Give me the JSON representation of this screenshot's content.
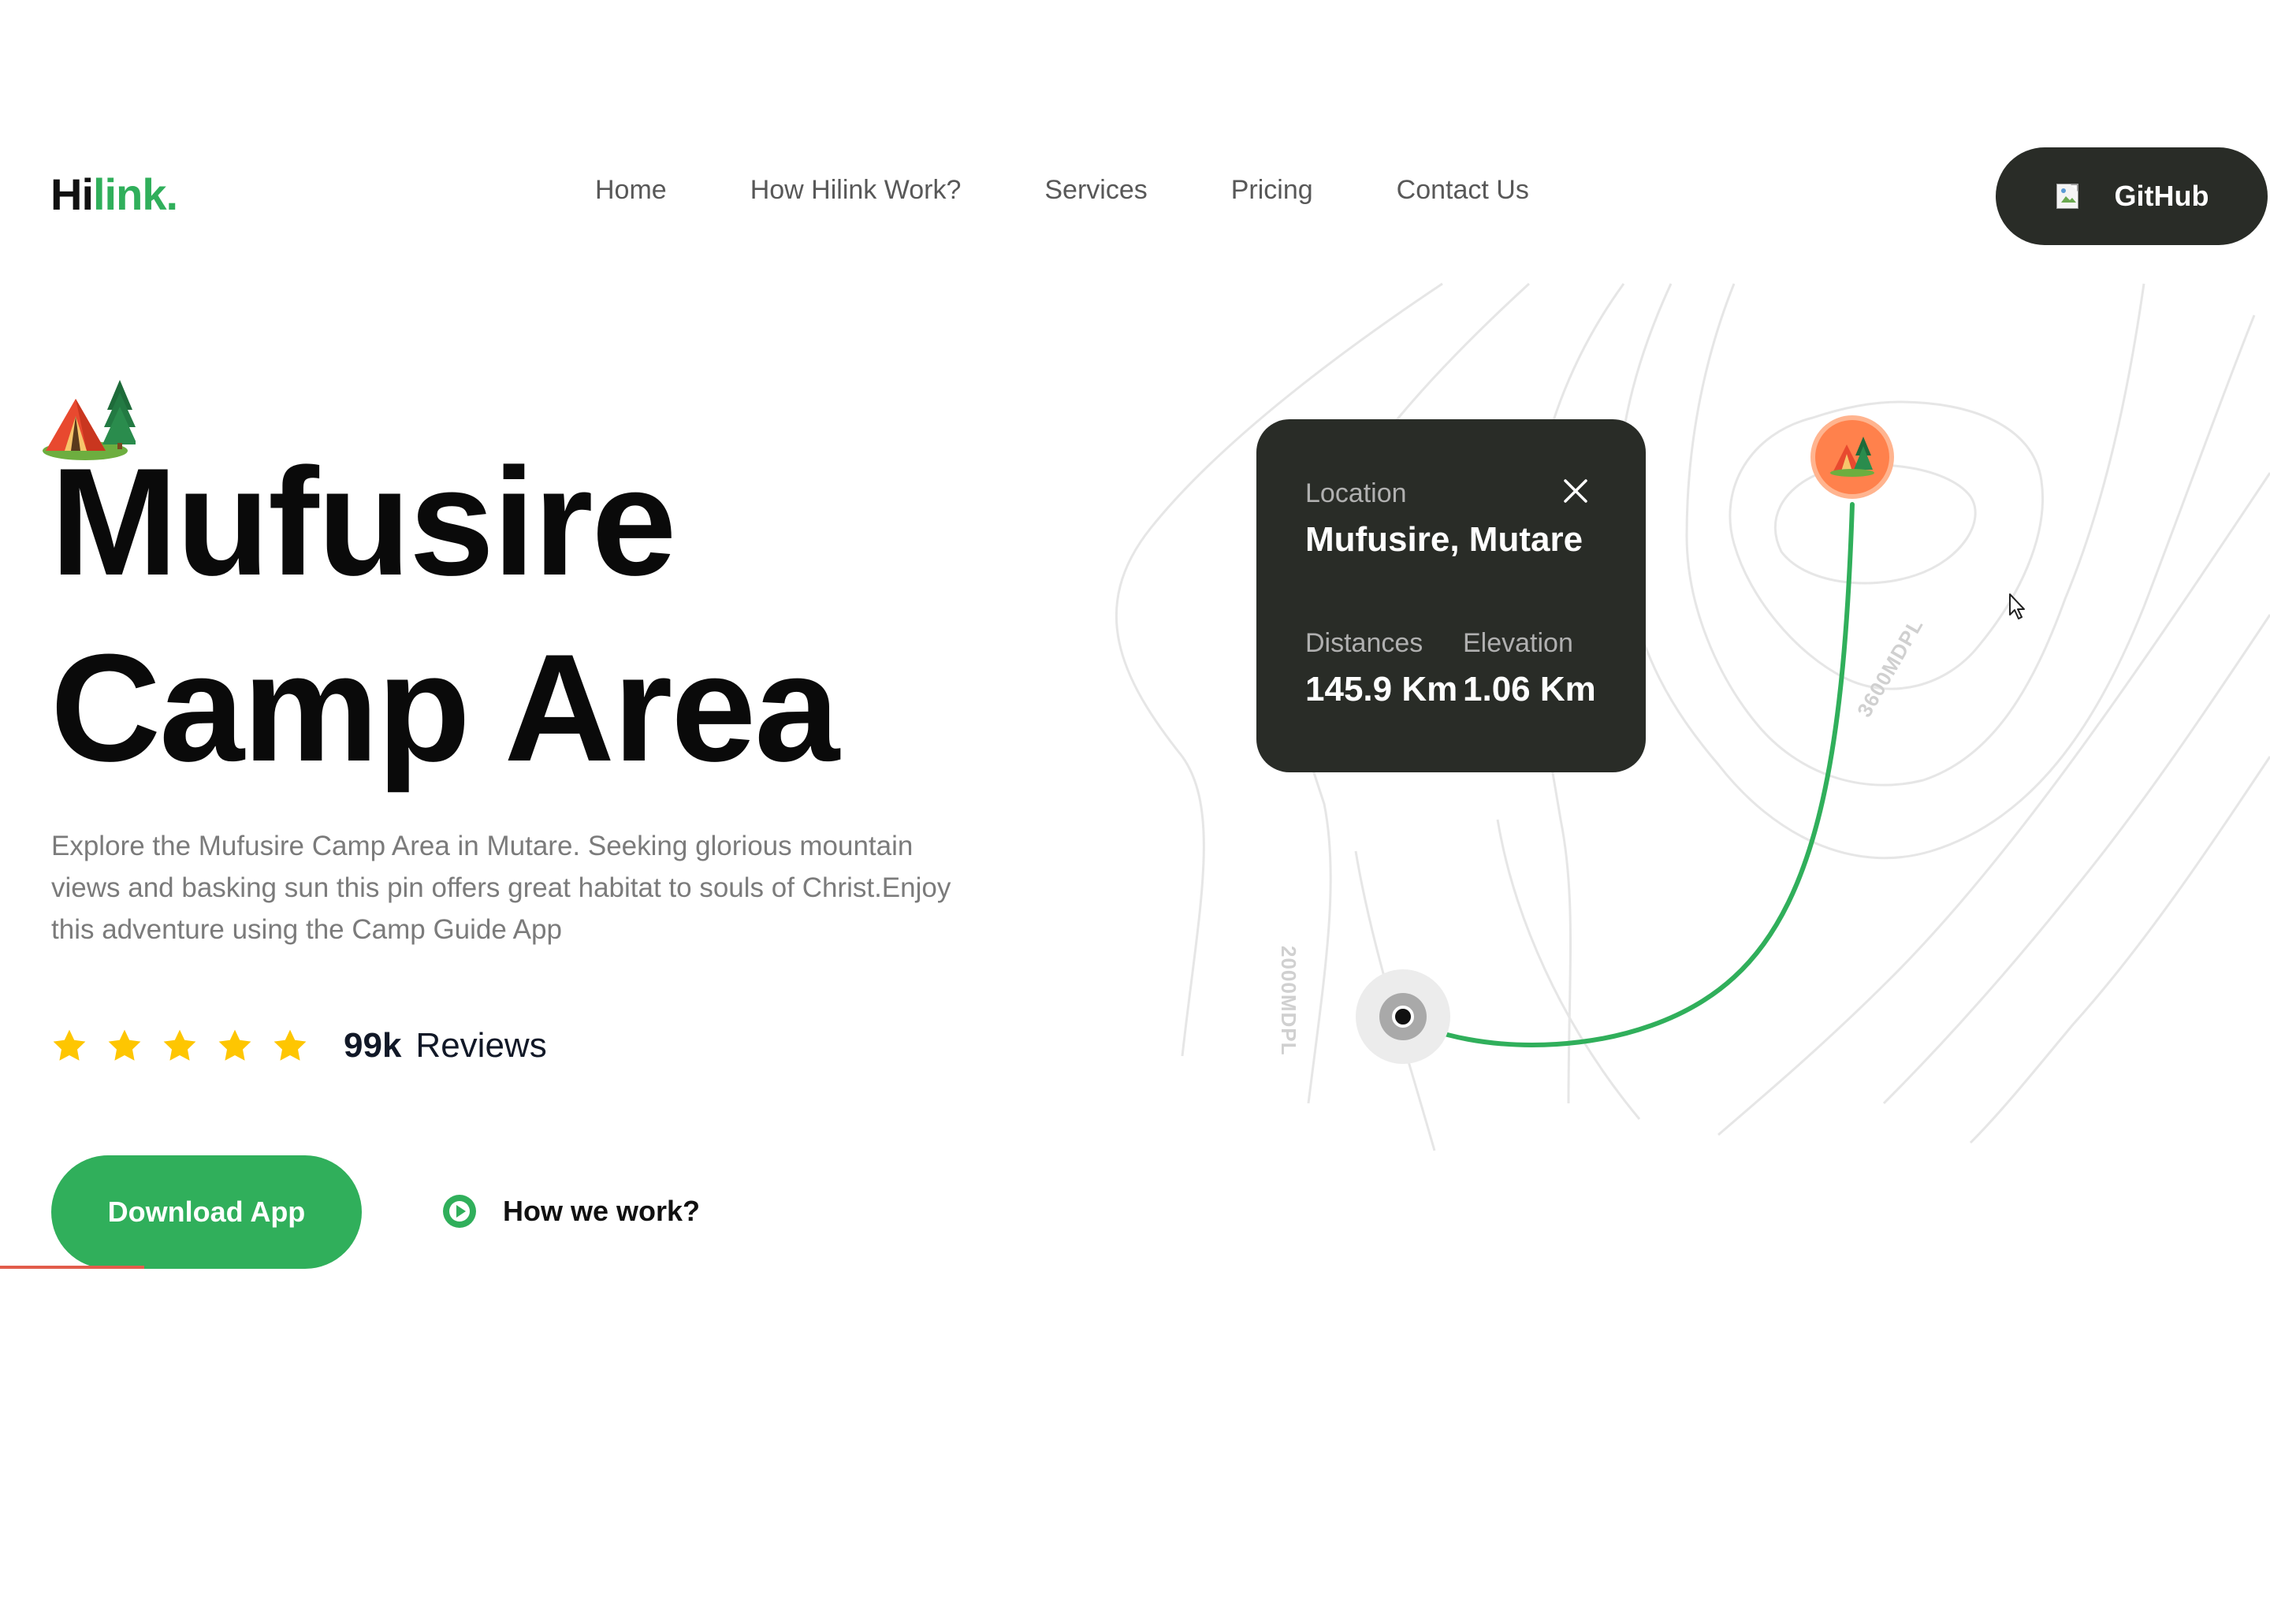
{
  "header": {
    "logo": {
      "prefix": "Hi",
      "accent": "link."
    },
    "nav": [
      {
        "label": "Home"
      },
      {
        "label": "How Hilink Work?"
      },
      {
        "label": "Services"
      },
      {
        "label": "Pricing"
      },
      {
        "label": "Contact Us"
      }
    ],
    "github_button": {
      "label": "GitHub",
      "icon": "broken-image-icon"
    }
  },
  "hero": {
    "icon": "camp-tent-icon",
    "title_line1": "Mufusire",
    "title_line2": "Camp Area",
    "description": "Explore the Mufusire Camp Area in Mutare. Seeking glorious mountain views and basking sun this pin offers great habitat to souls of Christ.Enjoy this adventure using the Camp Guide App",
    "rating": {
      "stars": 5,
      "count": "99k",
      "label": "Reviews"
    },
    "download_button": "Download App",
    "how_we_work": "How we work?"
  },
  "map": {
    "card": {
      "location_label": "Location",
      "location_name": "Mufusire, Mutare",
      "distance_label": "Distances",
      "elevation_label": "Elevation",
      "distance_value": "145.9 Km",
      "elevation_value": "1.06 Km"
    },
    "contour_labels": [
      "3600MDPL",
      "2000MDPL"
    ],
    "route_color": "#30AF5B",
    "destination_pin_color": "#FF814C"
  },
  "colors": {
    "brand_green": "#30AF5B",
    "dark": "#292C27",
    "star": "#FEC601",
    "text_gray": "#7B7B7B"
  }
}
